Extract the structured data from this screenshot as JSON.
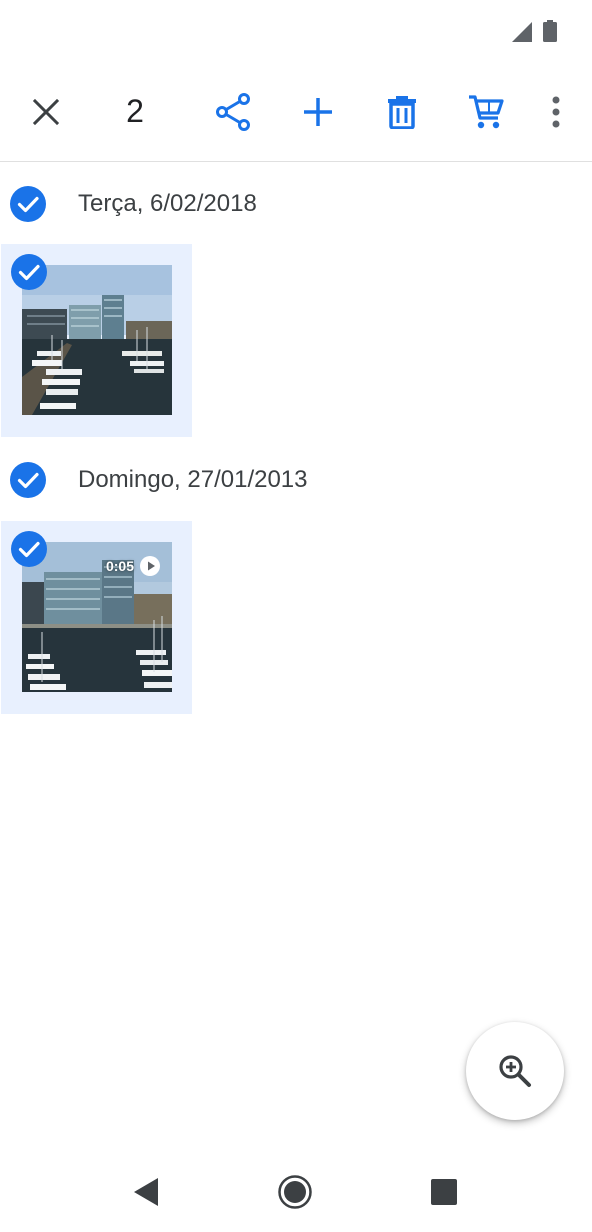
{
  "toolbar": {
    "selected_count": "2",
    "icons": [
      "close-icon",
      "share-icon",
      "add-icon",
      "delete-icon",
      "cart-icon",
      "more-vert-icon"
    ],
    "accent_color": "#1a73e8"
  },
  "groups": [
    {
      "date": "Terça, 6/02/2018",
      "items": [
        {
          "type": "photo",
          "selected": true,
          "subject": "harbor with boats and buildings"
        }
      ]
    },
    {
      "date": "Domingo, 27/01/2013",
      "items": [
        {
          "type": "video",
          "selected": true,
          "duration": "0:05",
          "subject": "harbor with boats and buildings"
        }
      ]
    }
  ],
  "fab": {
    "icon": "zoom-in-icon"
  },
  "nav_bar": {
    "icons": [
      "back-icon",
      "home-icon",
      "recents-icon"
    ]
  },
  "colors": {
    "selection_bg": "#e8f0fe",
    "check_blue": "#1a73e8"
  }
}
